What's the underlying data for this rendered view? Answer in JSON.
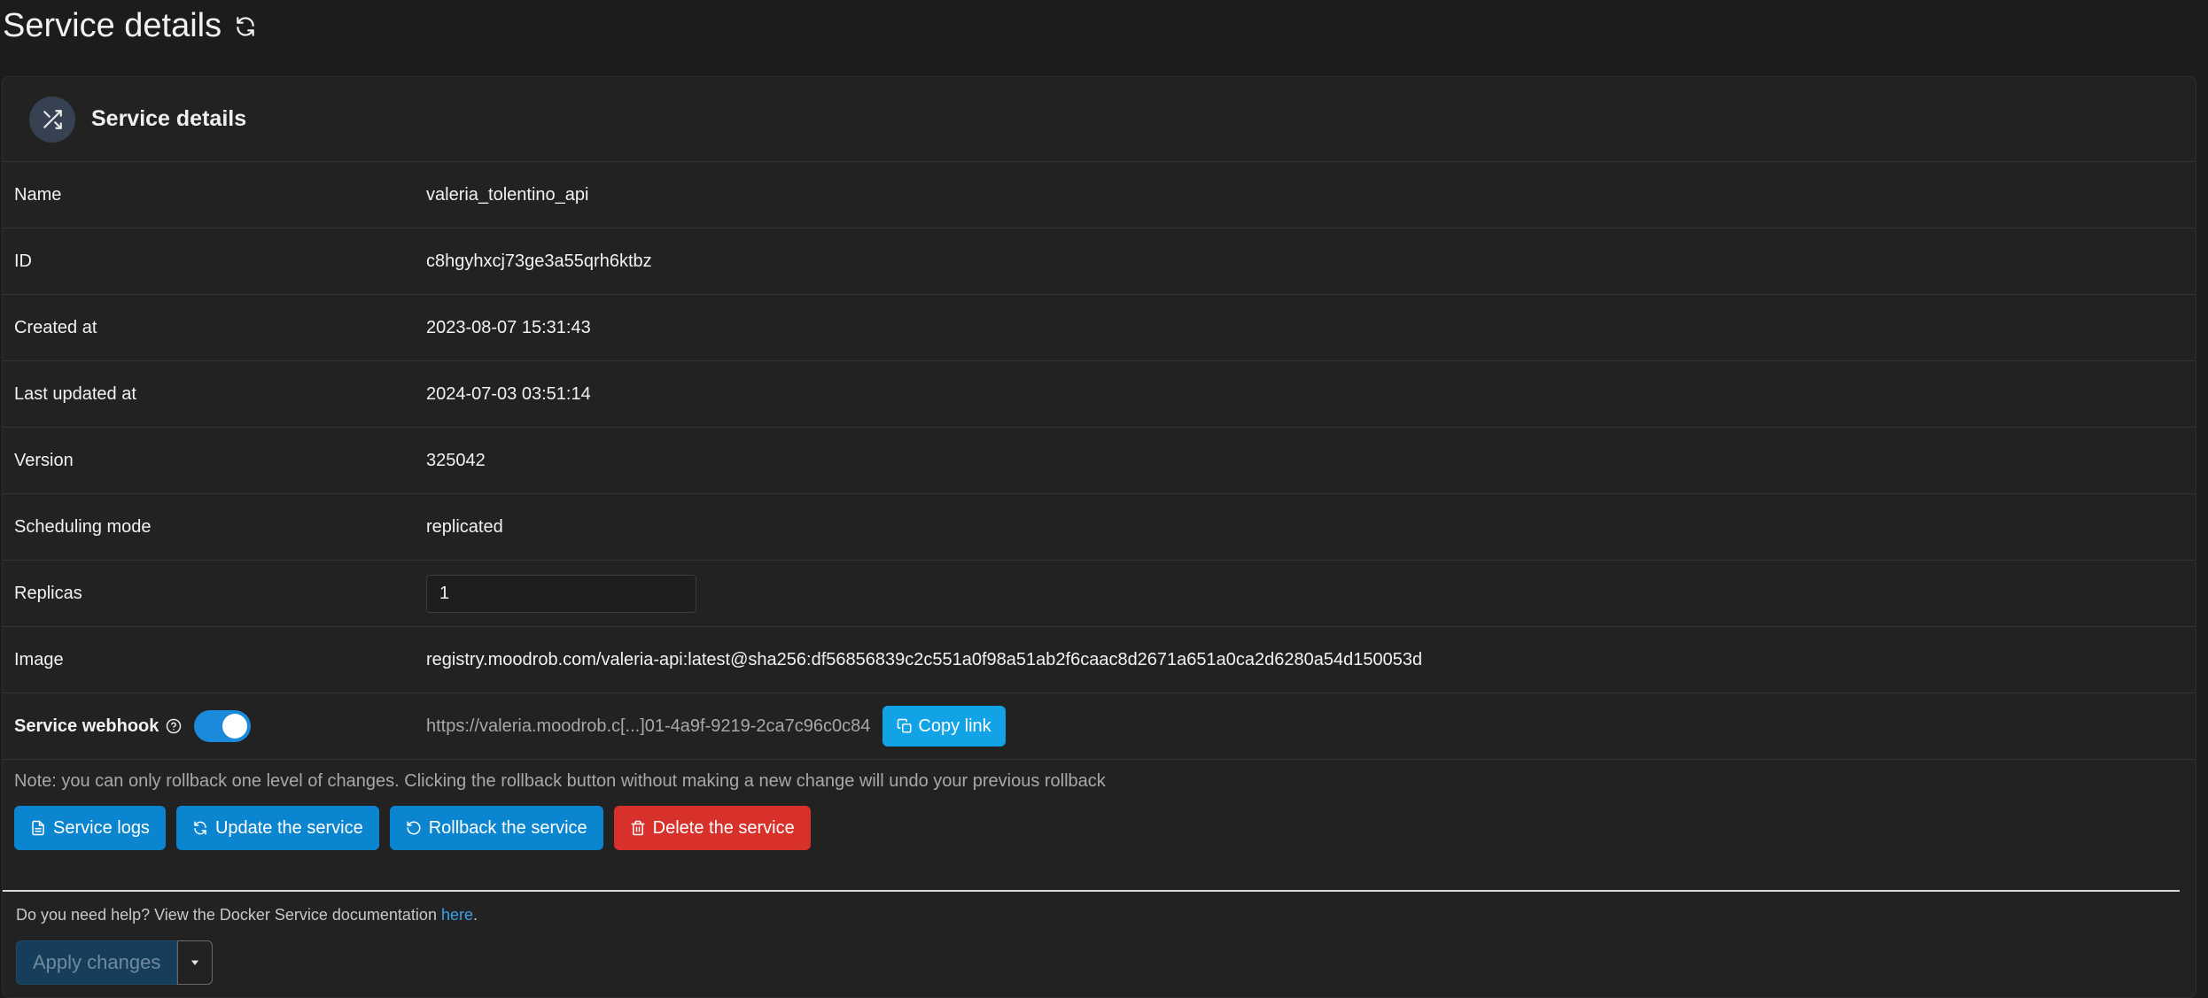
{
  "page": {
    "title": "Service details"
  },
  "panel": {
    "title": "Service details"
  },
  "details": {
    "name": {
      "label": "Name",
      "value": "valeria_tolentino_api"
    },
    "id": {
      "label": "ID",
      "value": "c8hgyhxcj73ge3a55qrh6ktbz"
    },
    "created": {
      "label": "Created at",
      "value": "2023-08-07 15:31:43"
    },
    "updated": {
      "label": "Last updated at",
      "value": "2024-07-03 03:51:14"
    },
    "version": {
      "label": "Version",
      "value": "325042"
    },
    "scheduling": {
      "label": "Scheduling mode",
      "value": "replicated"
    },
    "replicas": {
      "label": "Replicas",
      "value": "1"
    },
    "image": {
      "label": "Image",
      "value": "registry.moodrob.com/valeria-api:latest@sha256:df56856839c2c551a0f98a51ab2f6caac8d2671a651a0ca2d6280a54d150053d"
    },
    "webhook": {
      "label": "Service webhook",
      "enabled": true,
      "url": "https://valeria.moodrob.c[...]01-4a9f-9219-2ca7c96c0c84",
      "copy_label": "Copy link"
    }
  },
  "note": "Note: you can only rollback one level of changes. Clicking the rollback button without making a new change will undo your previous rollback",
  "actions": {
    "logs": "Service logs",
    "update": "Update the service",
    "rollback": "Rollback the service",
    "delete": "Delete the service"
  },
  "help": {
    "text": "Do you need help? View the Docker Service documentation ",
    "link": "here",
    "suffix": "."
  },
  "apply": {
    "label": "Apply changes"
  },
  "colors": {
    "primary": "#0b85cf",
    "copy": "#12a2e6",
    "danger": "#d8302b",
    "toggle": "#1b8adb",
    "background": "#1c1c1c",
    "panel": "#222222"
  }
}
